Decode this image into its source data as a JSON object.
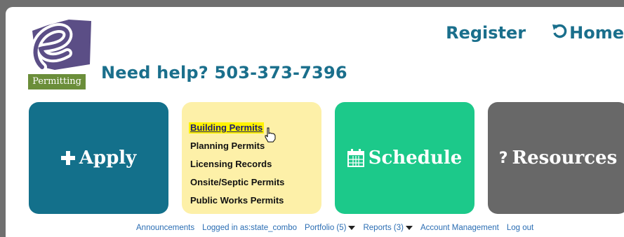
{
  "logo": {
    "letter": "e",
    "label": "Permitting",
    "accent": "#5b4e86"
  },
  "help": {
    "text": "Need help? 503-373-7396"
  },
  "topnav": {
    "register": "Register",
    "home": "Home"
  },
  "tiles": {
    "apply": {
      "label": "Apply",
      "icon": "plus-icon",
      "color": "#13708b"
    },
    "permits": {
      "color": "#fdf0a8",
      "links": [
        "Building Permits",
        "Planning Permits",
        "Licensing Records",
        "Onsite/Septic Permits",
        "Public Works Permits"
      ]
    },
    "schedule": {
      "label": "Schedule",
      "icon": "calendar-icon",
      "color": "#1cc98a"
    },
    "resources": {
      "label": "Resources",
      "icon": "question-icon",
      "color": "#686868"
    }
  },
  "bottomnav": {
    "announcements": "Announcements",
    "logged_in": "Logged in as:state_combo",
    "portfolio": "Portfolio (5)",
    "reports": "Reports (3)",
    "account": "Account Management",
    "logout": "Log out"
  }
}
